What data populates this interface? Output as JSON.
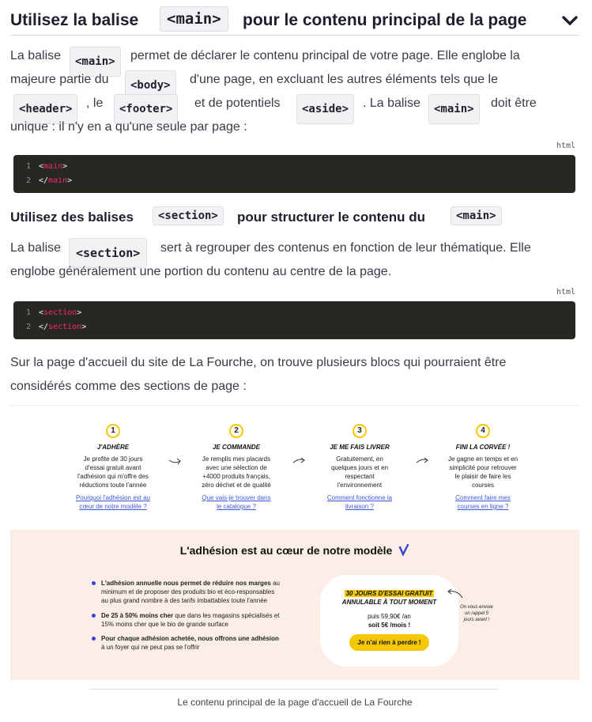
{
  "section1": {
    "title_before": "Utilisez la balise",
    "title_code": "<main>",
    "title_after": "pour le contenu principal de la page",
    "chevron_icon": "chevron-down-icon",
    "para_parts": [
      "La balise",
      "<main>",
      "permet de déclarer le contenu principal de votre page. Elle englobe la",
      "majeure partie du",
      "<body>",
      "d'une page, en excluant les autres éléments tels que le",
      "<header>",
      ", le",
      "<footer>",
      "et de potentiels",
      "<aside>",
      ". La balise",
      "<main>",
      "doit être",
      "unique : il n'y en a qu'une seule par page :"
    ],
    "code_lang": "html",
    "code_lines": [
      {
        "num": "1",
        "open": "<",
        "tag": "main",
        "close": ">"
      },
      {
        "num": "2",
        "open": "</",
        "tag": "main",
        "close": ">"
      }
    ]
  },
  "section2": {
    "title_before": "Utilisez des balises",
    "title_code1": "<section>",
    "title_mid": "pour structurer le contenu du",
    "title_code2": "<main>",
    "para_a": "La balise",
    "para_code": "<section>",
    "para_b": "sert à regrouper des contenus en fonction de leur thématique. Elle",
    "para_c": "englobe généralement une portion du contenu au centre de la page.",
    "code_lang": "html",
    "code_lines": [
      {
        "num": "1",
        "open": "<",
        "tag": "section",
        "close": ">"
      },
      {
        "num": "2",
        "open": "</",
        "tag": "section",
        "close": ">"
      }
    ],
    "para2_a": "Sur la page d'accueil du site de La Fourche, on trouve plusieurs blocs qui pourraient être",
    "para2_b": "considérés comme des sections de page :"
  },
  "figure": {
    "steps": [
      {
        "num": "1",
        "title": "J'ADHÈRE",
        "lines": [
          "Je profite de 30 jours",
          "d'essai gratuit avant",
          "l'adhésion qui m'offre des",
          "réductions toute l'année"
        ],
        "links": [
          "Pourquoi l'adhésion est au",
          "cœur de notre modèle ?"
        ]
      },
      {
        "num": "2",
        "title": "JE COMMANDE",
        "lines": [
          "Je remplis mes placards",
          "avec une sélection de",
          "+4000 produits français,",
          "zéro déchet et de qualité"
        ],
        "links": [
          "Que vais-je trouver dans",
          "le catalogue ?"
        ]
      },
      {
        "num": "3",
        "title": "JE ME FAIS LIVRER",
        "lines": [
          "Gratuitement, en",
          "quelques jours et en",
          "respectant",
          "l'environnement"
        ],
        "links": [
          "Comment fonctionne la",
          "livraison ?"
        ]
      },
      {
        "num": "4",
        "title": "FINI LA CORVÉE !",
        "lines": [
          "Je gagne en temps et en",
          "simplicité pour retrouver",
          "le plaisir de faire les",
          "courses"
        ],
        "links": [
          "Comment faire mes",
          "courses en ligne ?"
        ]
      }
    ],
    "promo": {
      "title": "L'adhésion est au cœur de notre modèle",
      "bullets": [
        {
          "bold": "L'adhésion annuelle nous permet de réduire nos marges",
          "rest": [
            "au",
            "minimum et de proposer des produits bio et éco-responsables",
            "au plus grand nombre à des tarifs imbattables toute l'année"
          ]
        },
        {
          "bold": "De 25 à 50% moins cher",
          "rest": [
            "que dans les magasins spécialisés et",
            "15% moins cher que le bio de grande surface"
          ]
        },
        {
          "bold": "Pour chaque adhésion achetée, nous offrons une adhésion",
          "rest": [
            "à un foyer qui ne peut pas se l'offrir"
          ]
        }
      ],
      "card_line1": "30 JOURS D'ESSAI GRATUIT",
      "card_line2": "ANNULABLE À TOUT MOMENT",
      "card_price1": "puis 59,90€ /an",
      "card_price2": "soit 5€ /mois !",
      "card_button": "Je n'ai rien à perdre !",
      "note": [
        "On vous envoie",
        "un rappel 5",
        "jours avant !"
      ]
    },
    "caption": "Le contenu principal de la page d'accueil de La Fourche"
  },
  "colors": {
    "accent_yellow": "#f5c800",
    "link_blue": "#3a5bd9",
    "promo_bg": "#faeee6",
    "code_bg": "#272822",
    "tag_pink": "#f92672"
  }
}
